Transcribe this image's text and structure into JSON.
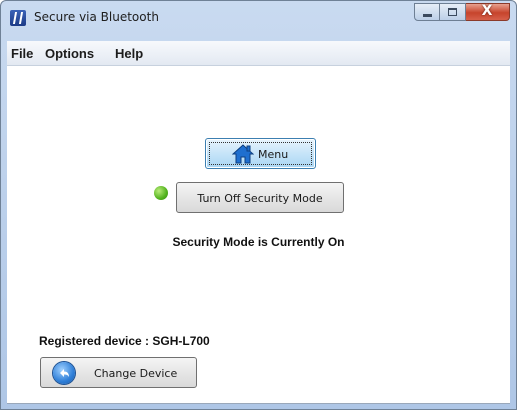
{
  "window": {
    "title": "Secure via Bluetooth",
    "app_icon": "bluetooth-app-icon",
    "controls": {
      "minimize_icon": "minimize-icon",
      "maximize_icon": "maximize-icon",
      "close_label": "X"
    }
  },
  "menubar": {
    "items": [
      {
        "label": "File"
      },
      {
        "label": "Options"
      },
      {
        "label": "Help"
      }
    ]
  },
  "main": {
    "menu_button": {
      "label": "Menu",
      "icon": "home-icon"
    },
    "security_indicator": {
      "icon": "status-dot-icon",
      "color": "#52b21e"
    },
    "security_button": {
      "label": "Turn Off Security Mode"
    },
    "status_text": "Security Mode is Currently On"
  },
  "footer": {
    "registered_device": "Registered device : SGH-L700",
    "change_button": {
      "label": "Change Device",
      "icon": "back-arrow-icon"
    }
  }
}
